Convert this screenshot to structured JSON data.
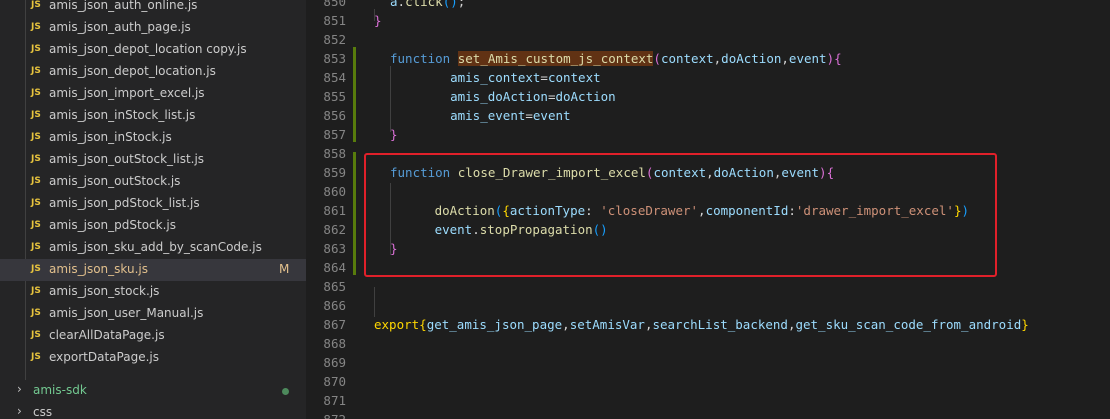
{
  "explorer": {
    "files": [
      {
        "name": "amis_json_auth_online.js",
        "icon": "js-icon",
        "status": ""
      },
      {
        "name": "amis_json_auth_page.js",
        "icon": "js-icon",
        "status": ""
      },
      {
        "name": "amis_json_depot_location copy.js",
        "icon": "js-icon",
        "status": ""
      },
      {
        "name": "amis_json_depot_location.js",
        "icon": "js-icon",
        "status": ""
      },
      {
        "name": "amis_json_import_excel.js",
        "icon": "js-icon",
        "status": ""
      },
      {
        "name": "amis_json_inStock_list.js",
        "icon": "js-icon",
        "status": ""
      },
      {
        "name": "amis_json_inStock.js",
        "icon": "js-icon",
        "status": ""
      },
      {
        "name": "amis_json_outStock_list.js",
        "icon": "js-icon",
        "status": ""
      },
      {
        "name": "amis_json_outStock.js",
        "icon": "js-icon",
        "status": ""
      },
      {
        "name": "amis_json_pdStock_list.js",
        "icon": "js-icon",
        "status": ""
      },
      {
        "name": "amis_json_pdStock.js",
        "icon": "js-icon",
        "status": ""
      },
      {
        "name": "amis_json_sku_add_by_scanCode.js",
        "icon": "js-icon",
        "status": ""
      },
      {
        "name": "amis_json_sku.js",
        "icon": "js-icon",
        "status": "M"
      },
      {
        "name": "amis_json_stock.js",
        "icon": "js-icon",
        "status": ""
      },
      {
        "name": "amis_json_user_Manual.js",
        "icon": "js-icon",
        "status": ""
      },
      {
        "name": "clearAllDataPage.js",
        "icon": "js-icon",
        "status": ""
      },
      {
        "name": "exportDataPage.js",
        "icon": "js-icon",
        "status": ""
      }
    ],
    "js_label": "JS",
    "folders": [
      {
        "name": "amis-sdk",
        "icon": "chevron-right-icon"
      },
      {
        "name": "css",
        "icon": "chevron-right-icon"
      }
    ]
  },
  "editor": {
    "line_numbers": [
      "850",
      "851",
      "852",
      "853",
      "854",
      "855",
      "856",
      "857",
      "858",
      "859",
      "860",
      "861",
      "862",
      "863",
      "864",
      "865",
      "866",
      "867",
      "868",
      "869",
      "870",
      "871",
      "872"
    ],
    "colors": {
      "keyword": "#569cd6",
      "function": "#dcdcaa",
      "variable": "#9cdcfe",
      "string": "#ce9178",
      "highlight_box": "#e0202a",
      "modified_gutter": "#587c0c"
    }
  }
}
